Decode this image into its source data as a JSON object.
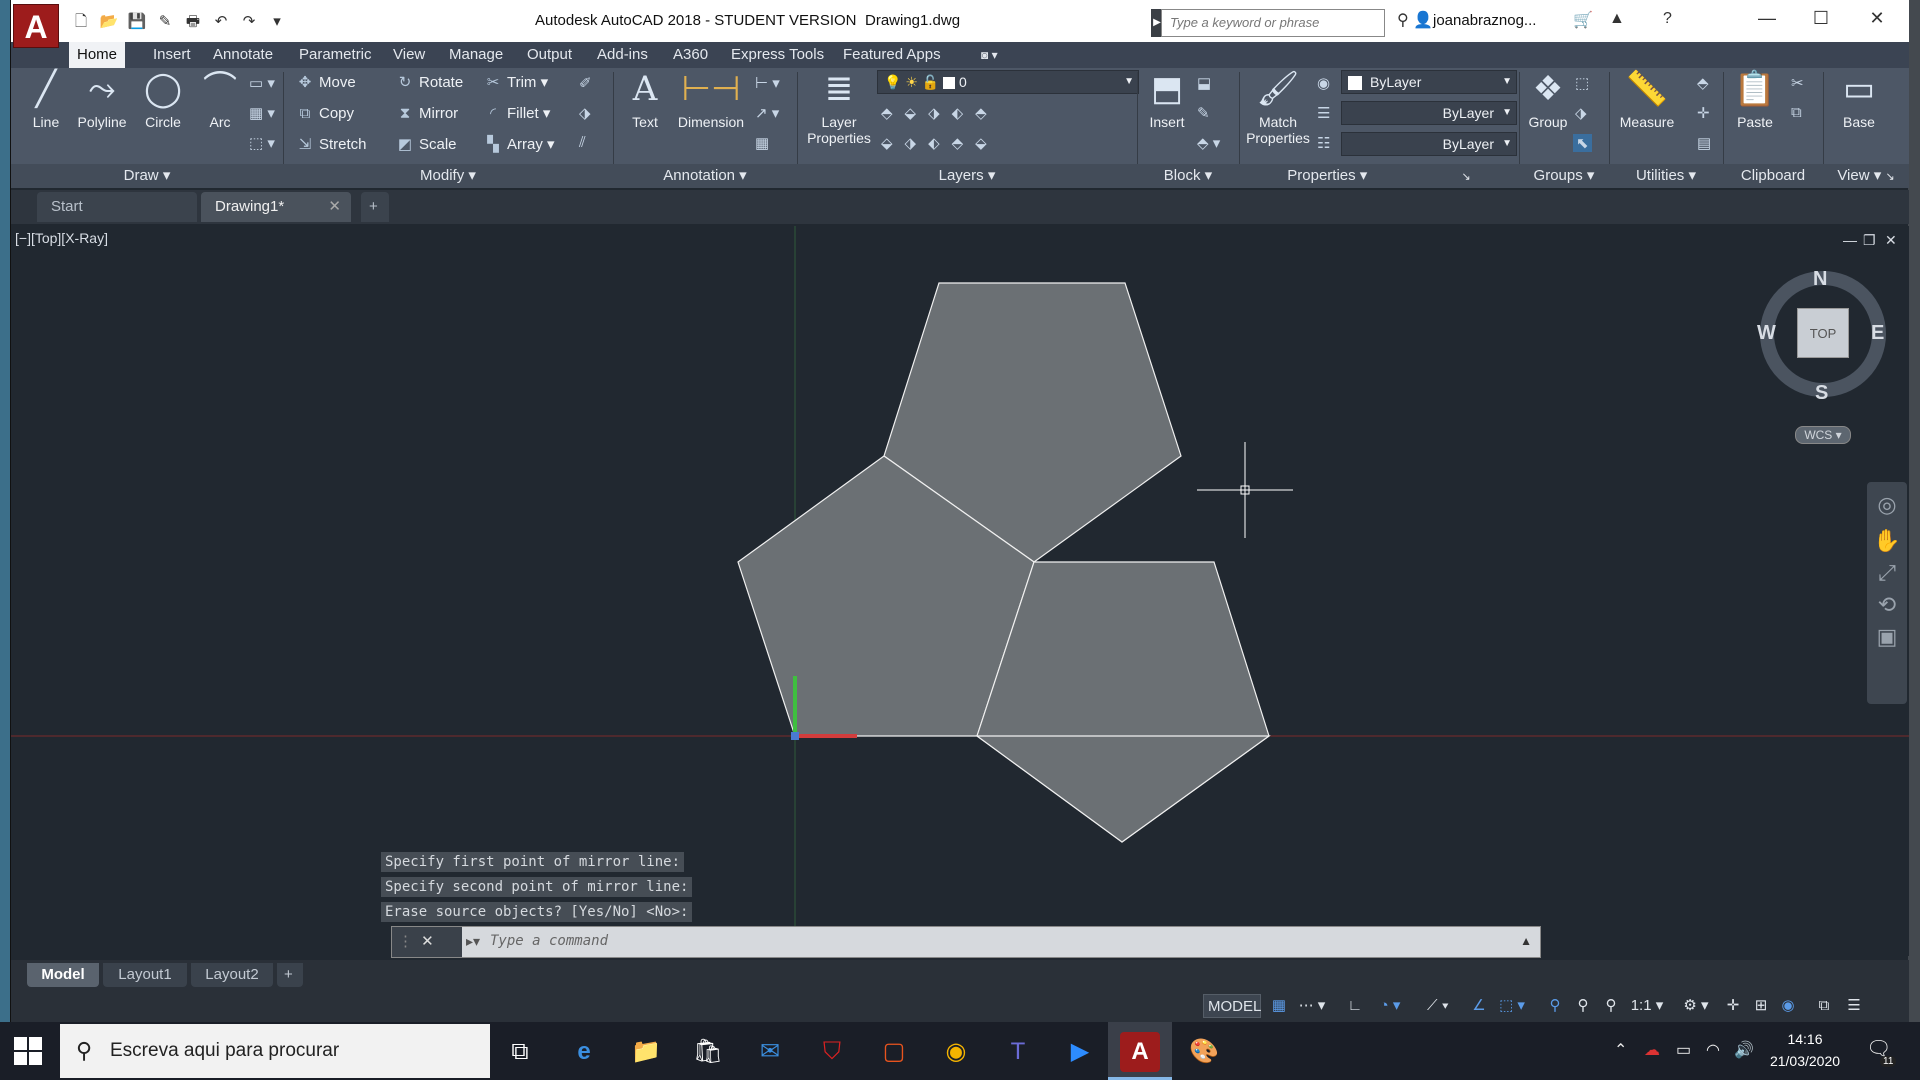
{
  "titlebar": {
    "app_title": "Autodesk AutoCAD 2018 - STUDENT VERSION",
    "document": "Drawing1.dwg",
    "search_placeholder": "Type a keyword or phrase",
    "username": "joanabraznog...",
    "logo_letter": "A"
  },
  "ribbon_tabs": [
    "Home",
    "Insert",
    "Annotate",
    "Parametric",
    "View",
    "Manage",
    "Output",
    "Add-ins",
    "A360",
    "Express Tools",
    "Featured Apps"
  ],
  "ribbon": {
    "draw": {
      "line": "Line",
      "polyline": "Polyline",
      "circle": "Circle",
      "arc": "Arc",
      "panel": "Draw"
    },
    "modify": {
      "move": "Move",
      "rotate": "Rotate",
      "trim": "Trim",
      "copy": "Copy",
      "mirror": "Mirror",
      "fillet": "Fillet",
      "stretch": "Stretch",
      "scale": "Scale",
      "array": "Array",
      "panel": "Modify"
    },
    "annotation": {
      "text": "Text",
      "dimension": "Dimension",
      "panel": "Annotation"
    },
    "layers": {
      "layer_properties_1": "Layer",
      "layer_properties_2": "Properties",
      "current_layer": "0",
      "panel": "Layers"
    },
    "block": {
      "insert": "Insert",
      "panel": "Block"
    },
    "properties": {
      "match_1": "Match",
      "match_2": "Properties",
      "color": "ByLayer",
      "linetype": "ByLayer",
      "lineweight": "ByLayer",
      "panel": "Properties"
    },
    "groups": {
      "group": "Group",
      "panel": "Groups"
    },
    "utilities": {
      "measure": "Measure",
      "panel": "Utilities"
    },
    "clipboard": {
      "paste": "Paste",
      "panel": "Clipboard"
    },
    "view": {
      "base": "Base",
      "panel": "View"
    }
  },
  "file_tabs": {
    "start": "Start",
    "drawing": "Drawing1*",
    "close": "✕",
    "new": "+"
  },
  "viewport": {
    "label": "[−][Top][X-Ray]",
    "viewcube": {
      "n": "N",
      "s": "S",
      "e": "E",
      "w": "W",
      "top": "TOP",
      "wcs": "WCS"
    }
  },
  "command": {
    "history": [
      "Specify first point of mirror line:",
      "Specify second point of mirror line:",
      "Erase source objects? [Yes/No] <No>:"
    ],
    "placeholder": "Type a command"
  },
  "layout_tabs": [
    "Model",
    "Layout1",
    "Layout2"
  ],
  "statusbar": {
    "model": "MODEL",
    "scale": "1:1"
  },
  "taskbar": {
    "search": "Escreva aqui para procurar",
    "time": "14:16",
    "date": "21/03/2020",
    "notif_count": "11"
  },
  "colors": {
    "viewport_bg": "#212830",
    "shape_fill": "#6b7074",
    "ribbon_bg": "#4d5766",
    "autocad_red": "#9d1c1c"
  }
}
